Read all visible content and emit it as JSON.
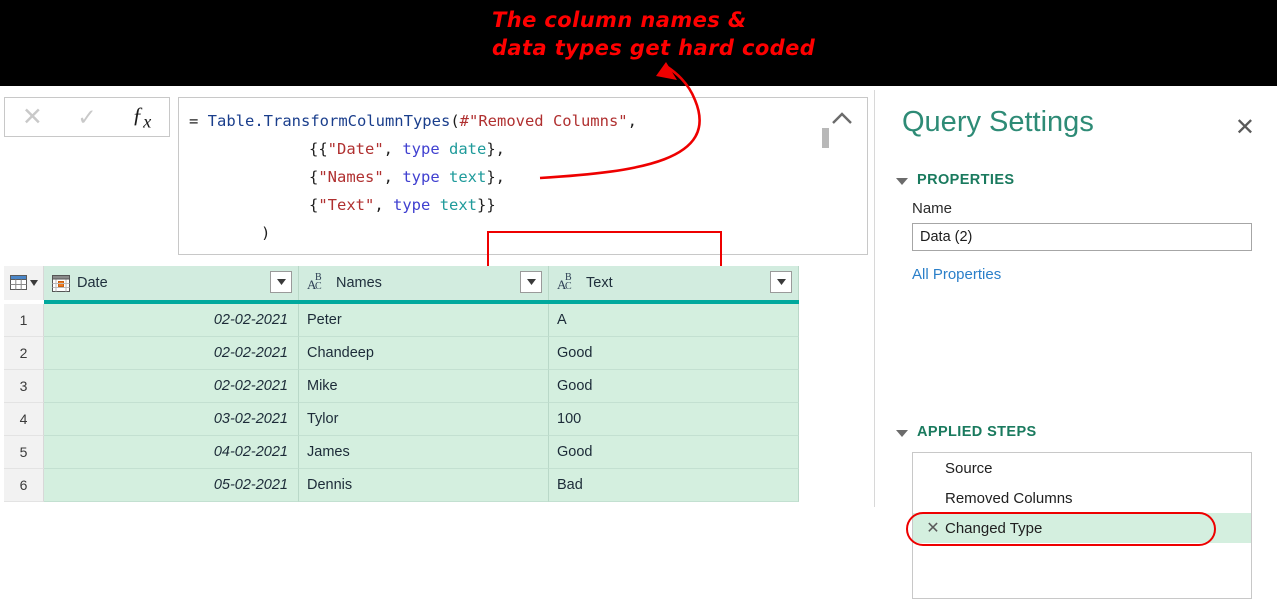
{
  "annotation": {
    "text": "The column names &\ndata types get hard coded",
    "color": "#ff0000",
    "arrow": "curved-red-arrow"
  },
  "formula_bar": {
    "cancel_icon": "close-icon",
    "confirm_icon": "checkmark-icon",
    "function_icon": "fx-icon",
    "collapse_icon": "chevron-up-icon",
    "code_lines": [
      {
        "indent": 0,
        "tokens": [
          {
            "t": "= ",
            "c": "punct"
          },
          {
            "t": "Table.TransformColumnTypes",
            "c": "fn"
          },
          {
            "t": "(",
            "c": "punct"
          },
          {
            "t": "#\"Removed Columns\"",
            "c": "str"
          },
          {
            "t": ",",
            "c": "punct"
          }
        ]
      },
      {
        "indent": 1,
        "tokens": [
          {
            "t": "{{",
            "c": "punct"
          },
          {
            "t": "\"Date\"",
            "c": "str"
          },
          {
            "t": ", ",
            "c": "punct"
          },
          {
            "t": "type",
            "c": "kw"
          },
          {
            "t": " ",
            "c": "punct"
          },
          {
            "t": "date",
            "c": "type"
          },
          {
            "t": "},",
            "c": "punct"
          }
        ]
      },
      {
        "indent": 1,
        "tokens": [
          {
            "t": "{",
            "c": "punct"
          },
          {
            "t": "\"Names\"",
            "c": "str"
          },
          {
            "t": ", ",
            "c": "punct"
          },
          {
            "t": "type",
            "c": "kw"
          },
          {
            "t": " ",
            "c": "punct"
          },
          {
            "t": "text",
            "c": "type"
          },
          {
            "t": "},",
            "c": "punct"
          }
        ]
      },
      {
        "indent": 1,
        "tokens": [
          {
            "t": "{",
            "c": "punct"
          },
          {
            "t": "\"Text\"",
            "c": "str"
          },
          {
            "t": ", ",
            "c": "punct"
          },
          {
            "t": "type",
            "c": "kw"
          },
          {
            "t": " ",
            "c": "punct"
          },
          {
            "t": "text",
            "c": "type"
          },
          {
            "t": "}}",
            "c": "punct"
          }
        ]
      },
      {
        "indent": 0.6,
        "tokens": [
          {
            "t": ")",
            "c": "punct"
          }
        ]
      }
    ]
  },
  "grid": {
    "corner_icon": "table-select-icon",
    "columns": [
      {
        "name": "Date",
        "type_icon": "calendar-icon",
        "align": "right"
      },
      {
        "name": "Names",
        "type_icon": "abc-text-icon",
        "align": "left"
      },
      {
        "name": "Text",
        "type_icon": "abc-text-icon",
        "align": "left"
      }
    ],
    "rows": [
      {
        "num": "1",
        "Date": "02-02-2021",
        "Names": "Peter",
        "Text": "A"
      },
      {
        "num": "2",
        "Date": "02-02-2021",
        "Names": "Chandeep",
        "Text": "Good"
      },
      {
        "num": "3",
        "Date": "02-02-2021",
        "Names": "Mike",
        "Text": "Good"
      },
      {
        "num": "4",
        "Date": "03-02-2021",
        "Names": "Tylor",
        "Text": "100"
      },
      {
        "num": "5",
        "Date": "04-02-2021",
        "Names": "James",
        "Text": "Good"
      },
      {
        "num": "6",
        "Date": "05-02-2021",
        "Names": "Dennis",
        "Text": "Bad"
      }
    ],
    "accent_color": "#00a99d",
    "header_bg": "#d2ecdf",
    "cell_bg": "#d4efdf"
  },
  "query_settings": {
    "title": "Query Settings",
    "close_icon": "close-icon",
    "properties": {
      "heading": "PROPERTIES",
      "name_label": "Name",
      "name_value": "Data (2)",
      "all_properties_link": "All Properties"
    },
    "applied_steps": {
      "heading": "APPLIED STEPS",
      "steps": [
        {
          "label": "Source",
          "selected": false,
          "delete_icon": false
        },
        {
          "label": "Removed Columns",
          "selected": false,
          "delete_icon": false
        },
        {
          "label": "Changed Type",
          "selected": true,
          "delete_icon": true
        }
      ]
    }
  }
}
